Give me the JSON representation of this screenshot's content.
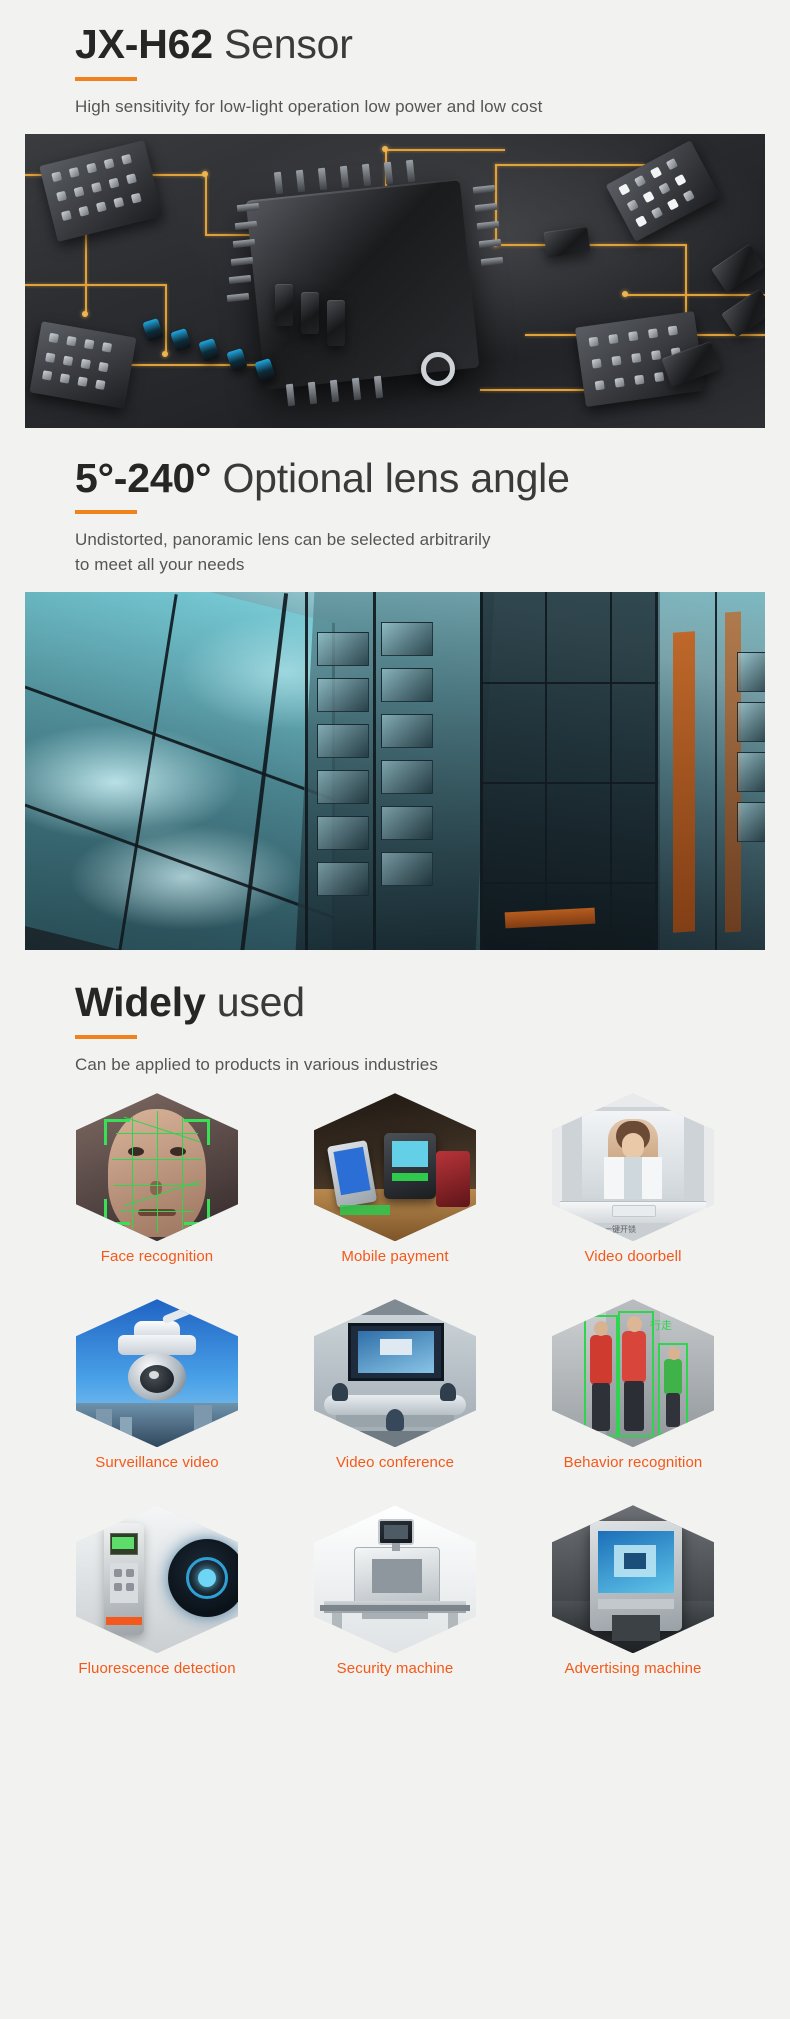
{
  "sections": [
    {
      "id": "sensor",
      "heading_bold": "JX-H62",
      "heading_light": " Sensor",
      "subtitle": "High sensitivity for low-light operation low power and low cost",
      "image_name": "circuit-board-photo"
    },
    {
      "id": "lens-angle",
      "heading_bold": "5°-240°",
      "heading_light": " Optional lens angle",
      "subtitle": "Undistorted, panoramic lens can be selected arbitrarily\nto meet all your needs",
      "image_name": "glass-building-photo"
    },
    {
      "id": "widely-used",
      "heading_bold": "Widely",
      "heading_light": " used",
      "subtitle": "Can be applied to products in various industries"
    }
  ],
  "applications": [
    {
      "label": "Face recognition",
      "icon": "face-recognition-photo"
    },
    {
      "label": "Mobile payment",
      "icon": "mobile-payment-photo"
    },
    {
      "label": "Video doorbell",
      "icon": "video-doorbell-photo"
    },
    {
      "label": "Surveillance video",
      "icon": "surveillance-camera-photo"
    },
    {
      "label": "Video conference",
      "icon": "video-conference-photo"
    },
    {
      "label": "Behavior recognition",
      "icon": "behavior-recognition-photo"
    },
    {
      "label": "Fluorescence detection",
      "icon": "fluorescence-detection-photo"
    },
    {
      "label": "Security machine",
      "icon": "security-scanner-photo"
    },
    {
      "label": "Advertising machine",
      "icon": "advertising-display-photo"
    }
  ],
  "doorbell_overlay_text": "一键开锁",
  "behavior_overlay_text": "行走",
  "colors": {
    "accent": "#f0821e",
    "label": "#f4591a",
    "heading": "#2b2b2b",
    "subtitle": "#555555",
    "background": "#f2f2f0"
  }
}
